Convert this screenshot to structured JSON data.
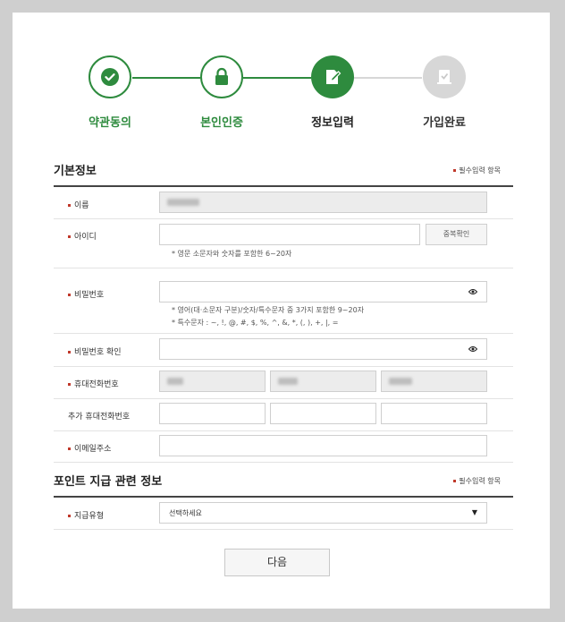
{
  "steps": [
    {
      "label": "약관동의",
      "icon": "check-icon",
      "state": "done"
    },
    {
      "label": "본인인증",
      "icon": "lock-icon",
      "state": "done"
    },
    {
      "label": "정보입력",
      "icon": "edit-icon",
      "state": "active"
    },
    {
      "label": "가입완료",
      "icon": "checklist-icon",
      "state": "todo"
    }
  ],
  "basic": {
    "title": "기본정보",
    "required_note": "필수입력 항목",
    "name_label": "이름",
    "id_label": "아이디",
    "id_dup_button": "중복확인",
    "id_hint": "* 영문 소문자와 숫자를 포함한 6~20자",
    "pw_label": "비밀번호",
    "pw_hint1": "* 영어(대·소문자 구분)/숫자/특수문자 중 3가지 포함한 9~20자",
    "pw_hint2": "* 특수문자 : ~, !, @, #, $, %, ^, &, *, (, ), +, |, =",
    "pw_confirm_label": "비밀번호 확인",
    "phone_label": "휴대전화번호",
    "extra_phone_label": "추가 휴대전화번호",
    "email_label": "이메일주소"
  },
  "point": {
    "title": "포인트 지급 관련 정보",
    "required_note": "필수입력 항목",
    "pay_type_label": "지급유형",
    "pay_type_value": "선택하세요"
  },
  "next_button": "다음",
  "colors": {
    "accent": "#2e8b3e",
    "required": "#c0392b"
  }
}
